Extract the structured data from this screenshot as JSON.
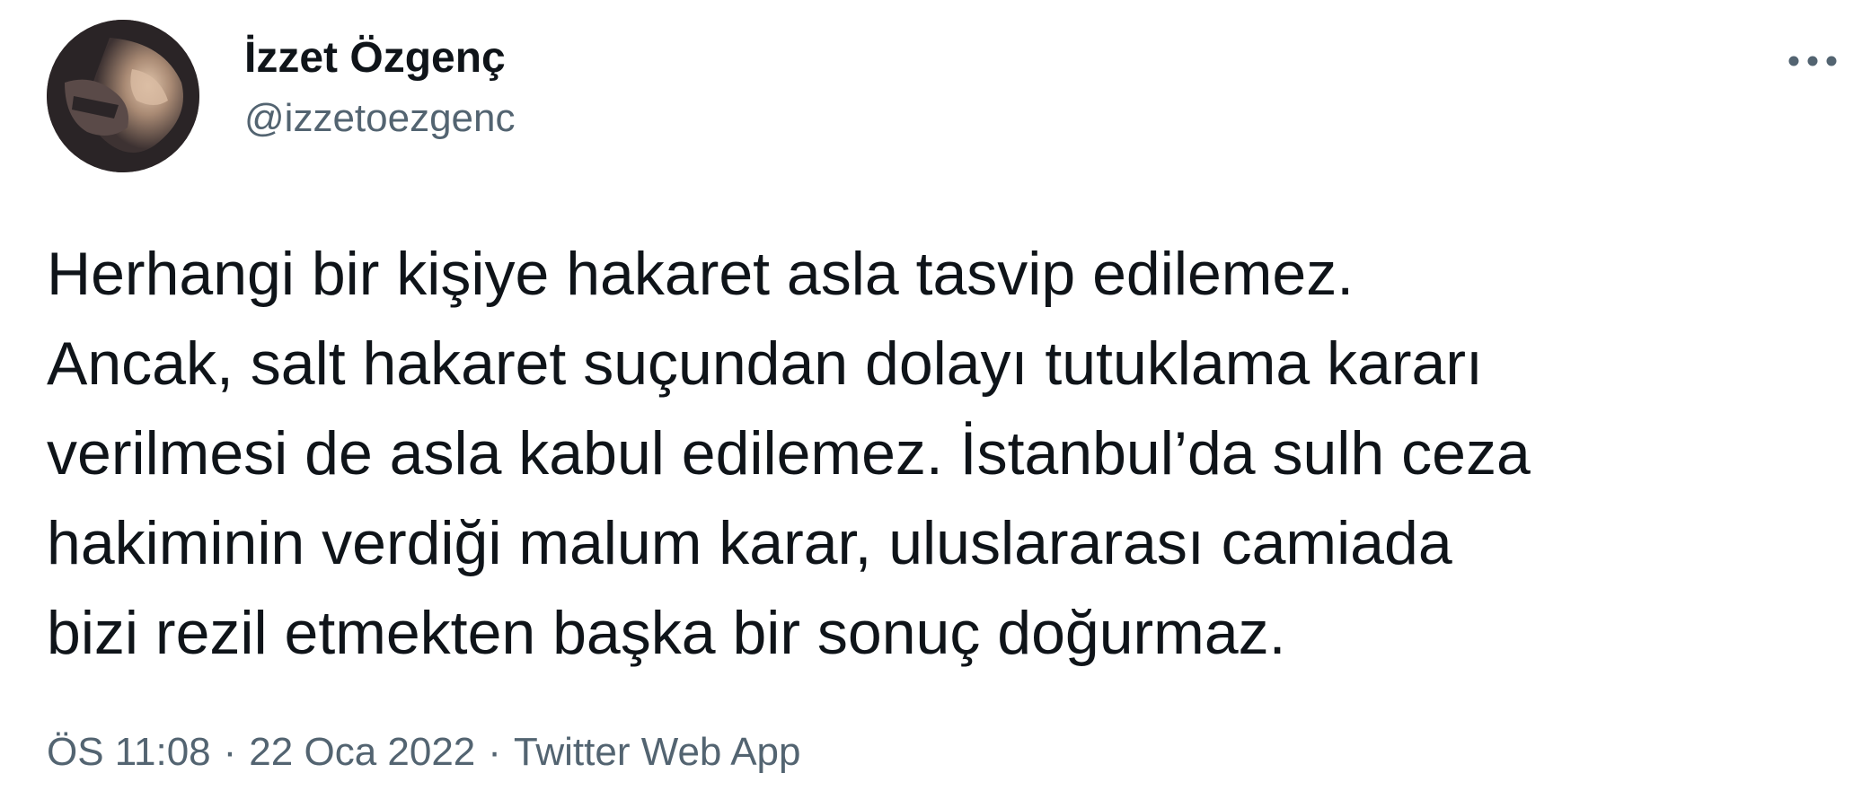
{
  "author": {
    "display_name": "İzzet Özgenç",
    "handle": "@izzetoezgenc",
    "avatar_icon": "profile-photo"
  },
  "menu": {
    "more_icon": "more-horizontal-icon"
  },
  "tweet": {
    "text": "Herhangi bir kişiye hakaret asla tasvip edilemez.\nAncak, salt hakaret suçundan dolayı tutuklama kararı\nverilmesi de asla kabul edilemez. İstanbul’da sulh ceza\nhakiminin verdiği malum karar, uluslararası camiada\nbizi rezil etmekten başka bir sonuç doğurmaz.",
    "time": "ÖS 11:08",
    "date": "22 Oca 2022",
    "source": "Twitter Web App",
    "separator": "·"
  },
  "colors": {
    "text_primary": "#0f1419",
    "text_secondary": "#536471",
    "background": "#ffffff"
  }
}
